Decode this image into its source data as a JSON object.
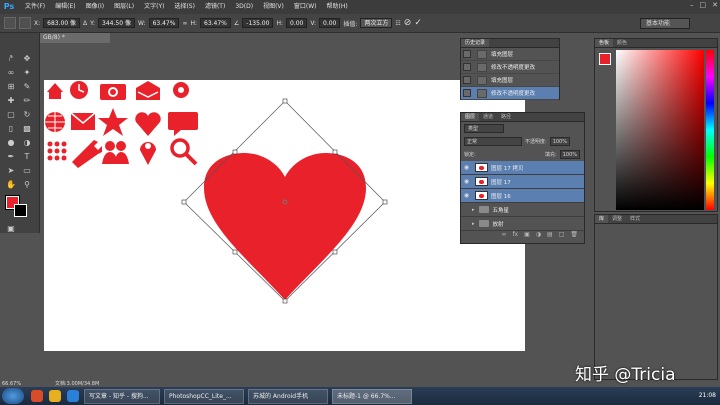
{
  "app": {
    "logo": "Ps"
  },
  "menu": [
    "文件(F)",
    "编辑(E)",
    "图像(I)",
    "图层(L)",
    "文字(Y)",
    "选择(S)",
    "滤镜(T)",
    "3D(D)",
    "视图(V)",
    "窗口(W)",
    "帮助(H)"
  ],
  "options": {
    "x_label": "X:",
    "x": "683.00 像",
    "y_label": "Y:",
    "y": "344.50 像",
    "w_label": "W:",
    "w": "63.47%",
    "h_label": "H:",
    "h": "63.47%",
    "angle": "-135.00",
    "h_skew_label": "H:",
    "h_skew": "0.00",
    "v_skew_label": "V:",
    "v_skew": "0.00",
    "interp_label": "插值:",
    "interp": "两次立方",
    "workspace": "基本功能"
  },
  "doc": {
    "tab": "GB/8) *",
    "zoom": "66.67%",
    "file_info": "文档:3.00M/34.8M"
  },
  "history": {
    "tabs": [
      "历史记录"
    ],
    "items": [
      "填充图层",
      "修改不透明度更改",
      "填充图层",
      "修改不透明度更改"
    ]
  },
  "layers": {
    "tabs": [
      "图层",
      "通道",
      "路径"
    ],
    "filter": "类型",
    "blend": "正常",
    "opacity_label": "不透明度:",
    "opacity": "100%",
    "lock_label": "锁定:",
    "fill_label": "填充:",
    "fill": "100%",
    "items": [
      {
        "name": "图层 17 拷贝"
      },
      {
        "name": "图层 17"
      },
      {
        "name": "图层 16"
      }
    ],
    "groups": [
      "五角星",
      "放射"
    ]
  },
  "color": {
    "tabs": [
      "色板",
      "颜色"
    ],
    "fg": "#e8212a"
  },
  "styles": {
    "tabs": [
      "库",
      "调整",
      "样式"
    ]
  },
  "taskbar": {
    "tasks": [
      "写文章 - 知乎 - 搜狗...",
      "PhotoshopCC_Lite_...",
      "苏城的 Android手机",
      "未标题-1 @ 66.7%..."
    ],
    "clock": "21:08"
  },
  "watermark": "知乎 @Tricia"
}
